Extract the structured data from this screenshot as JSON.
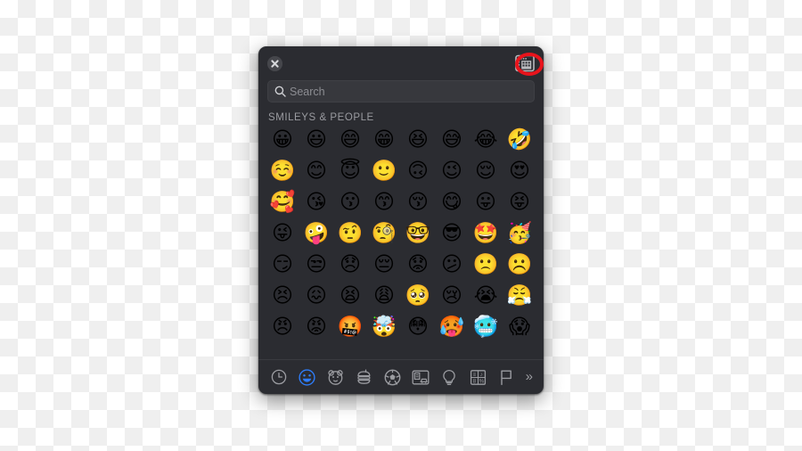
{
  "panel": {
    "title_bar": {
      "close_label": "Close",
      "close_icon": "close-circle-icon",
      "keyboard_button_icon": "keyboard-grid-icon",
      "keyboard_button_label": "Show Keyboard Viewer",
      "highlight_color": "#e8141c"
    },
    "search": {
      "icon": "search-icon",
      "placeholder": "Search",
      "value": ""
    },
    "sections": [
      {
        "title": "SMILEYS & PEOPLE",
        "rows": [
          [
            "😀",
            "😃",
            "😄",
            "😁",
            "😆",
            "😅",
            "😂",
            "🤣"
          ],
          [
            "☺️",
            "😊",
            "😇",
            "🙂",
            "🙃",
            "😉",
            "😌",
            "😍"
          ],
          [
            "🥰",
            "😘",
            "😗",
            "😙",
            "😚",
            "😋",
            "😛",
            "😝"
          ],
          [
            "😜",
            "🤪",
            "🤨",
            "🧐",
            "🤓",
            "😎",
            "🤩",
            "🥳"
          ],
          [
            "😏",
            "😒",
            "😞",
            "😔",
            "😟",
            "😕",
            "🙁",
            "☹️"
          ],
          [
            "😣",
            "😖",
            "😫",
            "😩",
            "🥺",
            "😢",
            "😭",
            "😤"
          ],
          [
            "😠",
            "😡",
            "🤬",
            "🤯",
            "😳",
            "🥵",
            "🥶",
            "😱"
          ]
        ]
      }
    ],
    "categories": [
      {
        "id": "recent",
        "icon": "clock-icon",
        "label": "Frequently Used",
        "active": false
      },
      {
        "id": "smileys",
        "icon": "smiley-face-icon",
        "label": "Smileys & People",
        "active": true
      },
      {
        "id": "nature",
        "icon": "animal-face-icon",
        "label": "Animals & Nature",
        "active": false
      },
      {
        "id": "food",
        "icon": "burger-icon",
        "label": "Food & Drink",
        "active": false
      },
      {
        "id": "activity",
        "icon": "soccer-ball-icon",
        "label": "Activity",
        "active": false
      },
      {
        "id": "travel",
        "icon": "car-building-icon",
        "label": "Travel & Places",
        "active": false
      },
      {
        "id": "objects",
        "icon": "lightbulb-icon",
        "label": "Objects",
        "active": false
      },
      {
        "id": "symbols",
        "icon": "symbols-grid-icon",
        "label": "Symbols",
        "active": false
      },
      {
        "id": "flags",
        "icon": "flag-icon",
        "label": "Flags",
        "active": false
      }
    ],
    "more_button": {
      "icon": "chevron-double-right-icon",
      "glyph": "»",
      "label": "More"
    }
  }
}
